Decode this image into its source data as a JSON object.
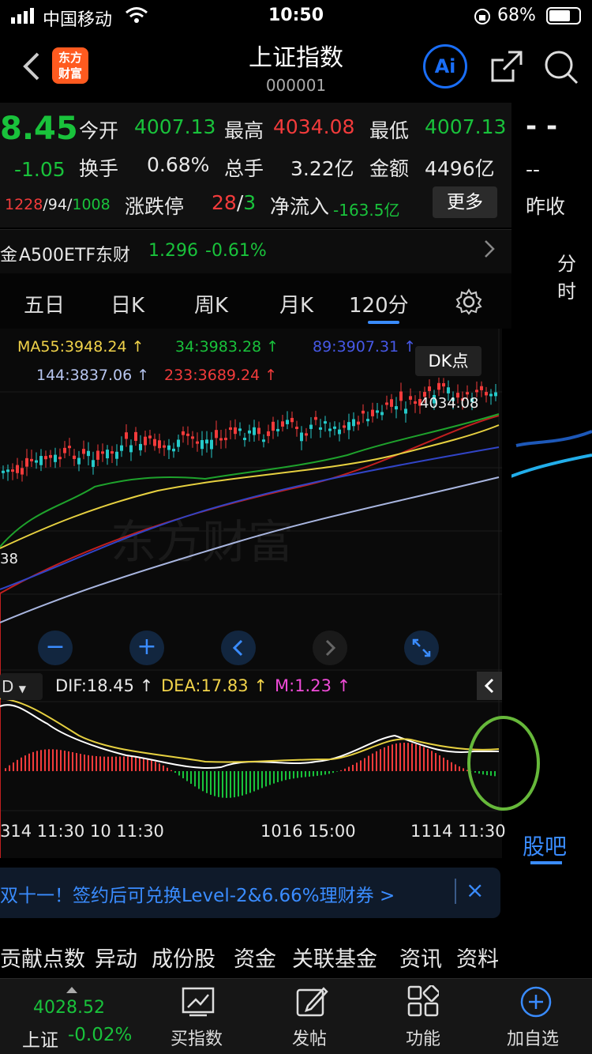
{
  "status": {
    "carrier": "中国移动",
    "time": "10:50",
    "battery": "68%"
  },
  "header": {
    "title": "上证指数",
    "code": "000001",
    "logo_line1": "东方",
    "logo_line2": "财富",
    "ai_label": "Ai"
  },
  "quote": {
    "price": "8.45",
    "change": "-1.05",
    "updown": "1228",
    "flat": "94",
    "down": "1008",
    "open_label": "今开",
    "open": "4007.13",
    "high_label": "最高",
    "high": "4034.08",
    "low_label": "最低",
    "low": "4007.13",
    "turnover_label": "换手",
    "turnover": "0.68%",
    "vol_label": "总手",
    "vol": "3.22亿",
    "amount_label": "金额",
    "amount": "4496亿",
    "limit_label": "涨跌停",
    "limit_up": "28",
    "limit_down": "3",
    "inflow_label": "净流入",
    "inflow": "-163.5亿",
    "more": "更多",
    "right_top": "- -",
    "right_mid": "--",
    "right_label": "昨收"
  },
  "etf": {
    "prefix": "金",
    "name": "A500ETF东财",
    "price": "1.296",
    "change": "-0.61%"
  },
  "side_tab": "分时",
  "tabs": [
    "五日",
    "日K",
    "周K",
    "月K",
    "120分"
  ],
  "ma": {
    "ma55": "MA55:3948.24",
    "ma34": "34:3983.28",
    "ma89": "89:3907.31",
    "ma144": "144:3837.06",
    "ma233": "233:3689.24",
    "dk": "DK点"
  },
  "chart": {
    "high_mark": "4034.08",
    "low_mark": "38",
    "watermark": "东方财富"
  },
  "macd": {
    "dif": "DIF:18.45",
    "dea": "DEA:17.83",
    "m": "M:1.23",
    "left": "D"
  },
  "axis": {
    "t1": "314 11:30",
    "t2": "10 11:30",
    "t3": "1016 15:00",
    "t4": "1114 11:30"
  },
  "guba": "股吧",
  "banner": "双十一！签约后可兑换Level-2&6.66%理财券 >",
  "sections": [
    "贡献点数",
    "异动",
    "成份股",
    "资金",
    "关联基金",
    "资讯",
    "资料"
  ],
  "bottom": {
    "index_value": "4028.52",
    "index_name": "上证",
    "index_change": "-0.02%",
    "buy": "买指数",
    "post": "发帖",
    "func": "功能",
    "add": "加自选"
  },
  "colors": {
    "up": "#f23b3b",
    "down": "#19c23b",
    "accent": "#3a8cff"
  }
}
